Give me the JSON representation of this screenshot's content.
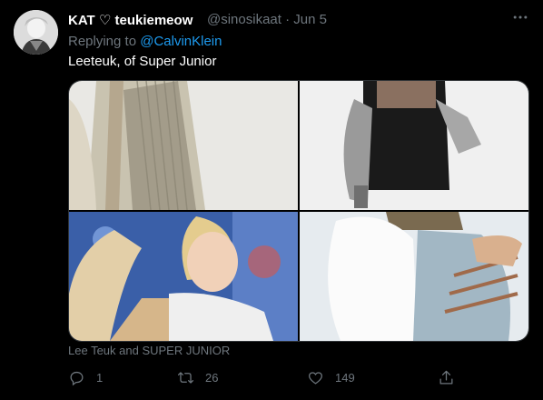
{
  "tweet": {
    "display_name": "KAT ♡ teukiemeow",
    "handle_time": "@sinosikaat · Jun 5",
    "reply_prefix": "Replying to ",
    "reply_mention": "@CalvinKlein",
    "text": "Leeteuk, of Super Junior",
    "media_caption": "Lee Teuk and SUPER JUNIOR",
    "replies_count": "1",
    "retweets_count": "26",
    "likes_count": "149"
  },
  "colors": {
    "background": "#000000",
    "secondary_text": "#6e767d",
    "link": "#1d9bf0"
  },
  "icons": [
    "more-icon",
    "reply-icon",
    "retweet-icon",
    "like-icon",
    "share-icon"
  ]
}
